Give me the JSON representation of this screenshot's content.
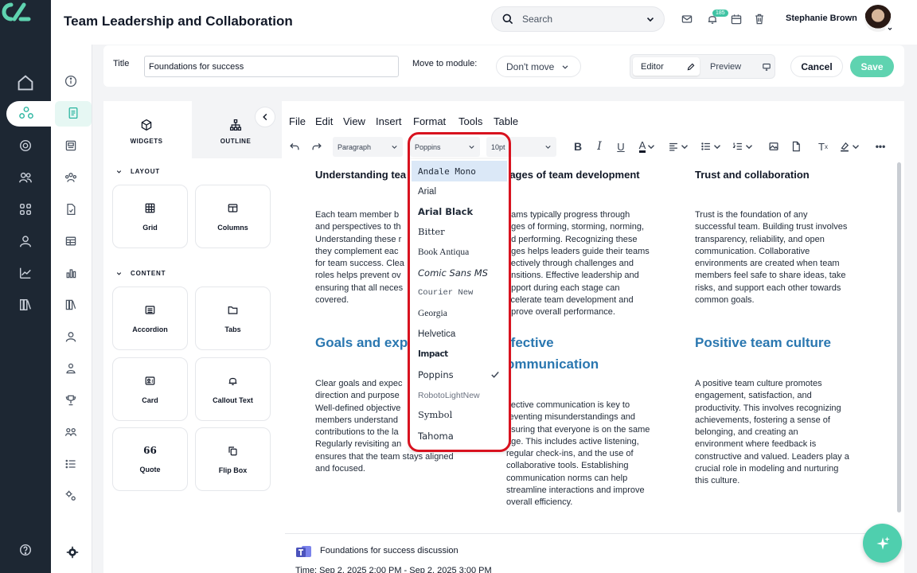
{
  "header": {
    "title": "Team Leadership and Collaboration",
    "search_placeholder": "Search",
    "notification_count": "185",
    "user_name": "Stephanie Brown"
  },
  "form": {
    "title_label": "Title",
    "title_value": "Foundations for success",
    "move_label": "Move to module:",
    "move_value": "Don't move",
    "editor_label": "Editor",
    "preview_label": "Preview",
    "cancel_label": "Cancel",
    "save_label": "Save"
  },
  "panel": {
    "tabs": [
      "WIDGETS",
      "OUTLINE"
    ],
    "layout_heading": "LAYOUT",
    "content_heading": "CONTENT",
    "layout_items": [
      "Grid",
      "Columns"
    ],
    "content_items": [
      "Accordion",
      "Tabs",
      "Card",
      "Callout Text",
      "Quote",
      "Flip Box"
    ]
  },
  "editor": {
    "menu": [
      "File",
      "Edit",
      "View",
      "Insert",
      "Format",
      "Tools",
      "Table"
    ],
    "block_format": "Paragraph",
    "font_family": "Poppins",
    "font_size": "10pt"
  },
  "font_dropdown": {
    "items": [
      "Andale Mono",
      "Arial",
      "Arial Black",
      "Bitter",
      "Book Antiqua",
      "Comic Sans MS",
      "Courier New",
      "Georgia",
      "Helvetica",
      "Impact",
      "Poppins",
      "RobotoLightNew",
      "Symbol",
      "Tahoma"
    ],
    "highlighted": "Andale Mono",
    "selected": "Poppins"
  },
  "content": {
    "col1": {
      "heading": "Understanding tea",
      "para": "Each team member b... and perspectives to th... Understanding these r... they complement eac... for team success. Cle... roles helps prevent ov... ensuring that all neces... covered.",
      "lines": [
        "Each team member b",
        "and perspectives to th",
        "Understanding these r",
        "they complement eac",
        "for team success. Clea",
        "roles helps prevent ov",
        "ensuring that all neces",
        "covered."
      ],
      "heading2": "Goals and exp",
      "lines2": [
        "Clear goals and expec",
        "direction and purpose",
        "Well-defined objective",
        "members understand",
        "contributions to the la",
        "Regularly revisiting an",
        "ensures that the team stays aligned",
        "and focused."
      ]
    },
    "col2": {
      "heading": "tages of team development",
      "lines": [
        "eams typically progress through",
        "ages of forming, storming, norming,",
        "nd performing. Recognizing these",
        "ages helps leaders guide their teams",
        "ffectively through challenges and",
        "ansitions. Effective leadership and",
        "upport during each stage can",
        "ccelerate team development and",
        "nprove overall performance."
      ],
      "heading2a": "ffective",
      "heading2b": "ommunication",
      "lines2": [
        "ffective communication is key to",
        "reventing misunderstandings and",
        "nsuring that everyone is on the same",
        "age. This includes active listening,",
        "regular check-ins, and the use of",
        "collaborative tools. Establishing",
        "communication norms can help",
        "streamline interactions and improve",
        "overall efficiency."
      ]
    },
    "col3": {
      "heading": "Trust and collaboration",
      "lines": [
        "Trust is the foundation of any",
        "successful team. Building trust involves",
        "transparency, reliability, and open",
        "communication. Collaborative",
        "environments are created when team",
        "members feel safe to share ideas, take",
        "risks, and support each other towards",
        "common goals."
      ],
      "heading2": "Positive team culture",
      "lines2": [
        "A positive team culture promotes",
        "engagement, satisfaction, and",
        "productivity. This involves recognizing",
        "achievements, fostering a sense of",
        "belonging, and creating an",
        "environment where feedback is",
        "constructive and valued. Leaders play a",
        "crucial role in modeling and nurturing",
        "this culture."
      ]
    }
  },
  "discussion": {
    "title": "Foundations for success discussion",
    "time": "Time: Sep 2, 2025 2:00 PM - Sep 2, 2025 3:00 PM"
  },
  "colors": {
    "accent": "#5fd3b0",
    "heading_blue": "#2a77b0",
    "highlight_ring": "#d8121f",
    "rail": "#1d2733"
  }
}
